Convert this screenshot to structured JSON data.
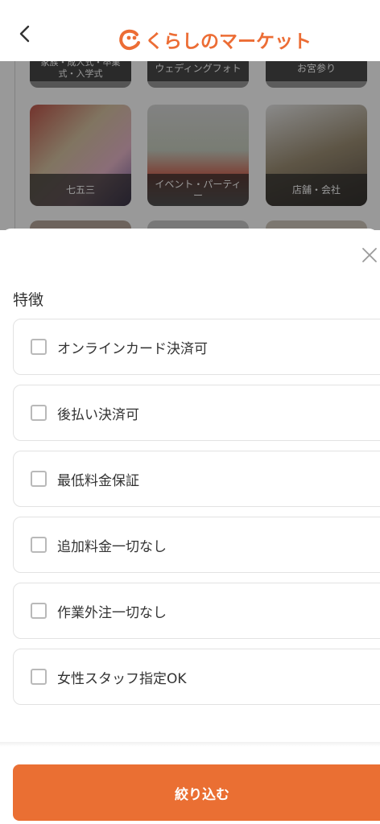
{
  "header": {
    "logo_text": "くらしのマーケット",
    "brand_color": "#ec6d35"
  },
  "categories": [
    {
      "label": "家族・成人式・卒業式・入学式"
    },
    {
      "label": "ウェディングフォト"
    },
    {
      "label": "お宮参り"
    },
    {
      "label": "七五三"
    },
    {
      "label": "イベント・パーティー"
    },
    {
      "label": "店舗・会社"
    }
  ],
  "filter": {
    "section_title": "特徴",
    "options": [
      {
        "label": "オンラインカード決済可",
        "checked": false
      },
      {
        "label": "後払い決済可",
        "checked": false
      },
      {
        "label": "最低料金保証",
        "checked": false
      },
      {
        "label": "追加料金一切なし",
        "checked": false
      },
      {
        "label": "作業外注一切なし",
        "checked": false
      },
      {
        "label": "女性スタッフ指定OK",
        "checked": false
      }
    ],
    "apply_label": "絞り込む",
    "apply_color": "#ea6f33"
  }
}
